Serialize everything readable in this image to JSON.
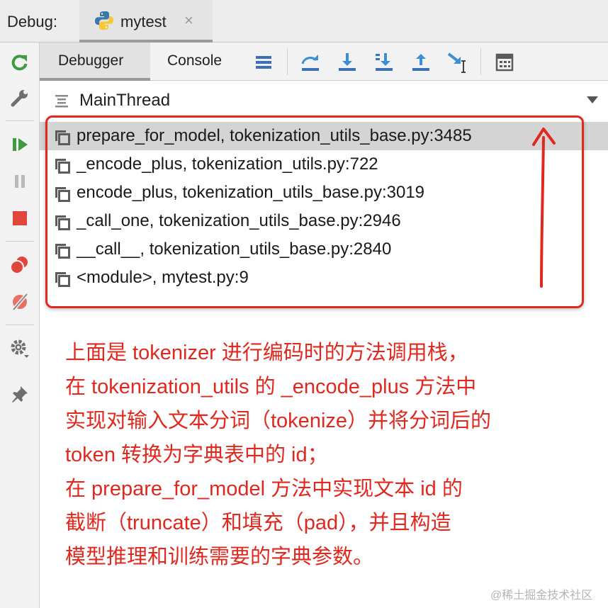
{
  "debug_bar": {
    "label": "Debug:",
    "session_tab": {
      "name": "mytest",
      "icon": "python-icon",
      "close": "×"
    }
  },
  "left_toolbar": {
    "icons": [
      "rerun-icon",
      "wrench-icon",
      "resume-icon",
      "pause-icon",
      "stop-icon",
      "view-breakpoints-icon",
      "mute-breakpoints-icon",
      "settings-icon",
      "pin-icon"
    ]
  },
  "tabs": {
    "debugger": "Debugger",
    "console": "Console"
  },
  "toolbar_icons": [
    "show-execution-point-icon",
    "step-over-icon",
    "step-into-icon",
    "step-into-my-code-icon",
    "step-out-icon",
    "run-to-cursor-icon",
    "evaluate-expression-icon"
  ],
  "thread": {
    "name": "MainThread"
  },
  "frames": [
    {
      "text": "prepare_for_model, tokenization_utils_base.py:3485",
      "selected": true
    },
    {
      "text": "_encode_plus, tokenization_utils.py:722",
      "selected": false
    },
    {
      "text": "encode_plus, tokenization_utils_base.py:3019",
      "selected": false
    },
    {
      "text": "_call_one, tokenization_utils_base.py:2946",
      "selected": false
    },
    {
      "text": "__call__, tokenization_utils_base.py:2840",
      "selected": false
    },
    {
      "text": "<module>, mytest.py:9",
      "selected": false
    }
  ],
  "annotation": {
    "color": "#e0281e",
    "lines": [
      "上面是 tokenizer 进行编码时的方法调用栈，",
      "在 tokenization_utils 的 _encode_plus 方法中",
      "实现对输入文本分词（tokenize）并将分词后的",
      "token 转换为字典表中的 id；",
      "在 prepare_for_model 方法中实现文本 id 的",
      "截断（truncate）和填充（pad），并且构造",
      "模型推理和训练需要的字典参数。"
    ]
  },
  "watermark": "@稀土掘金技术社区"
}
